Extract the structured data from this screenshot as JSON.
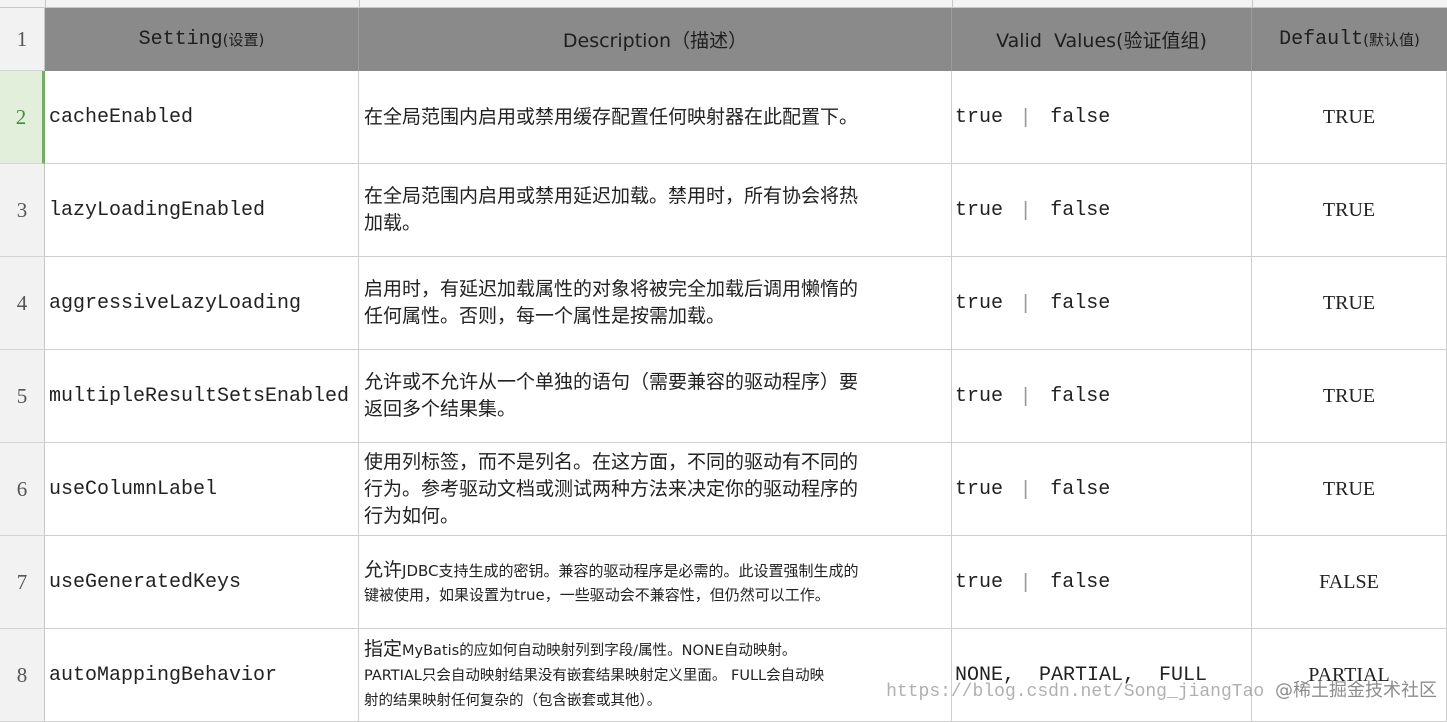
{
  "headers": {
    "row": "1",
    "setting_en": "Setting",
    "setting_cn": "(设置)",
    "description": "Description（描述）",
    "valid": "Valid  Values(验证值组)",
    "default_en": "Default",
    "default_cn": "(默认值)"
  },
  "rows": [
    {
      "num": "2",
      "setting": "cacheEnabled",
      "desc": [
        "在全局范围内启用或禁用缓存配置任何映射器在此配置下。"
      ],
      "valid_a": "true",
      "valid_b": "false",
      "default": "TRUE"
    },
    {
      "num": "3",
      "setting": "lazyLoadingEnabled",
      "desc": [
        "在全局范围内启用或禁用延迟加载。禁用时，所有协会将热",
        "加载。"
      ],
      "valid_a": "true",
      "valid_b": "false",
      "default": "TRUE"
    },
    {
      "num": "4",
      "setting": "aggressiveLazyLoading",
      "desc": [
        "启用时，有延迟加载属性的对象将被完全加载后调用懒惰的",
        "任何属性。否则，每一个属性是按需加载。"
      ],
      "valid_a": "true",
      "valid_b": "false",
      "default": "TRUE"
    },
    {
      "num": "5",
      "setting": "multipleResultSetsEnabled",
      "desc": [
        "允许或不允许从一个单独的语句（需要兼容的驱动程序）要",
        "返回多个结果集。"
      ],
      "valid_a": "true",
      "valid_b": "false",
      "default": "TRUE"
    },
    {
      "num": "6",
      "setting": "useColumnLabel",
      "desc": [
        "使用列标签，而不是列名。在这方面，不同的驱动有不同的",
        "行为。参考驱动文档或测试两种方法来决定你的驱动程序的",
        "行为如何。"
      ],
      "valid_a": "true",
      "valid_b": "false",
      "default": "TRUE"
    },
    {
      "num": "7",
      "setting": "useGeneratedKeys",
      "desc_big": "允许",
      "desc": [
        "JDBC支持生成的密钥。兼容的驱动程序是必需的。此设置强制生成的",
        "键被使用，如果设置为true，一些驱动会不兼容性，但仍然可以工作。"
      ],
      "valid_a": "true",
      "valid_b": "false",
      "default": "FALSE"
    },
    {
      "num": "8",
      "setting": "autoMappingBehavior",
      "desc_big": "指定",
      "desc": [
        "MyBatis的应如何自动映射列到字段/属性。NONE自动映射。",
        "PARTIAL只会自动映射结果没有嵌套结果映射定义里面。  FULL会自动映",
        "射的结果映射任何复杂的（包含嵌套或其他）。"
      ],
      "valid_text": "NONE,  PARTIAL,  FULL",
      "default": "PARTIAL"
    }
  ],
  "watermark": {
    "url": "https://blog.csdn.net/Song_jiangTao",
    "brand": "@稀土掘金技术社区"
  }
}
